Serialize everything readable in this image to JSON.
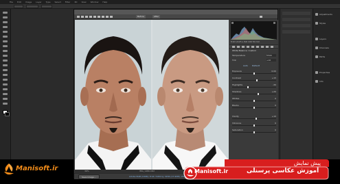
{
  "photoshop": {
    "menu": [
      "File",
      "Edit",
      "Image",
      "Layer",
      "Type",
      "Select",
      "Filter",
      "3D",
      "View",
      "Window",
      "Help"
    ],
    "dock_panels": [
      "Adjustments",
      "Styles",
      "Layers",
      "Channels",
      "Paths",
      "Properties",
      "Info"
    ]
  },
  "camera_raw": {
    "title": "Camera Raw 8.7 - Canon EOS 60D",
    "compare_tag_before": "Before",
    "compare_tag_after": "After",
    "zoom": "36%",
    "filename": "IMG_1480.CR2",
    "histogram_info": "f/10  1/125 s  ISO 100  50 mm",
    "panel_title": "Basic",
    "white_balance_label": "White Balance:",
    "white_balance_value": "Custom",
    "temperature_label": "Temperature",
    "temperature_value": "5500",
    "tint_label": "Tint",
    "tint_value": "+10",
    "auto_label": "Auto",
    "default_label": "Default",
    "sliders": [
      {
        "label": "Exposure",
        "value": "0.00",
        "level": 0.5
      },
      {
        "label": "Contrast",
        "value": "+15",
        "level": 0.57
      },
      {
        "label": "Highlights",
        "value": "-30",
        "level": 0.35
      },
      {
        "label": "Shadows",
        "value": "+20",
        "level": 0.6
      },
      {
        "label": "Whites",
        "value": "0",
        "level": 0.5
      },
      {
        "label": "Blacks",
        "value": "0",
        "level": 0.5
      },
      {
        "label": "Clarity",
        "value": "+10",
        "level": 0.55
      },
      {
        "label": "Vibrance",
        "value": "0",
        "level": 0.5
      },
      {
        "label": "Saturation",
        "value": "0",
        "level": 0.5
      }
    ],
    "save_button": "Save Image...",
    "workflow_link": "Adobe RGB (1998); 8 bit; 5184 by 3456 (17.9MP); 240 ppi"
  },
  "watermark": {
    "text": "Manisoft.ir"
  },
  "banner": {
    "subtitle": "پیش نمایش",
    "title": "آموزش عکاسی پرسنلی",
    "site": "Manisoft.ir"
  },
  "colors": {
    "brand_orange": "#f28c1a",
    "banner_red": "#d81e1e"
  }
}
